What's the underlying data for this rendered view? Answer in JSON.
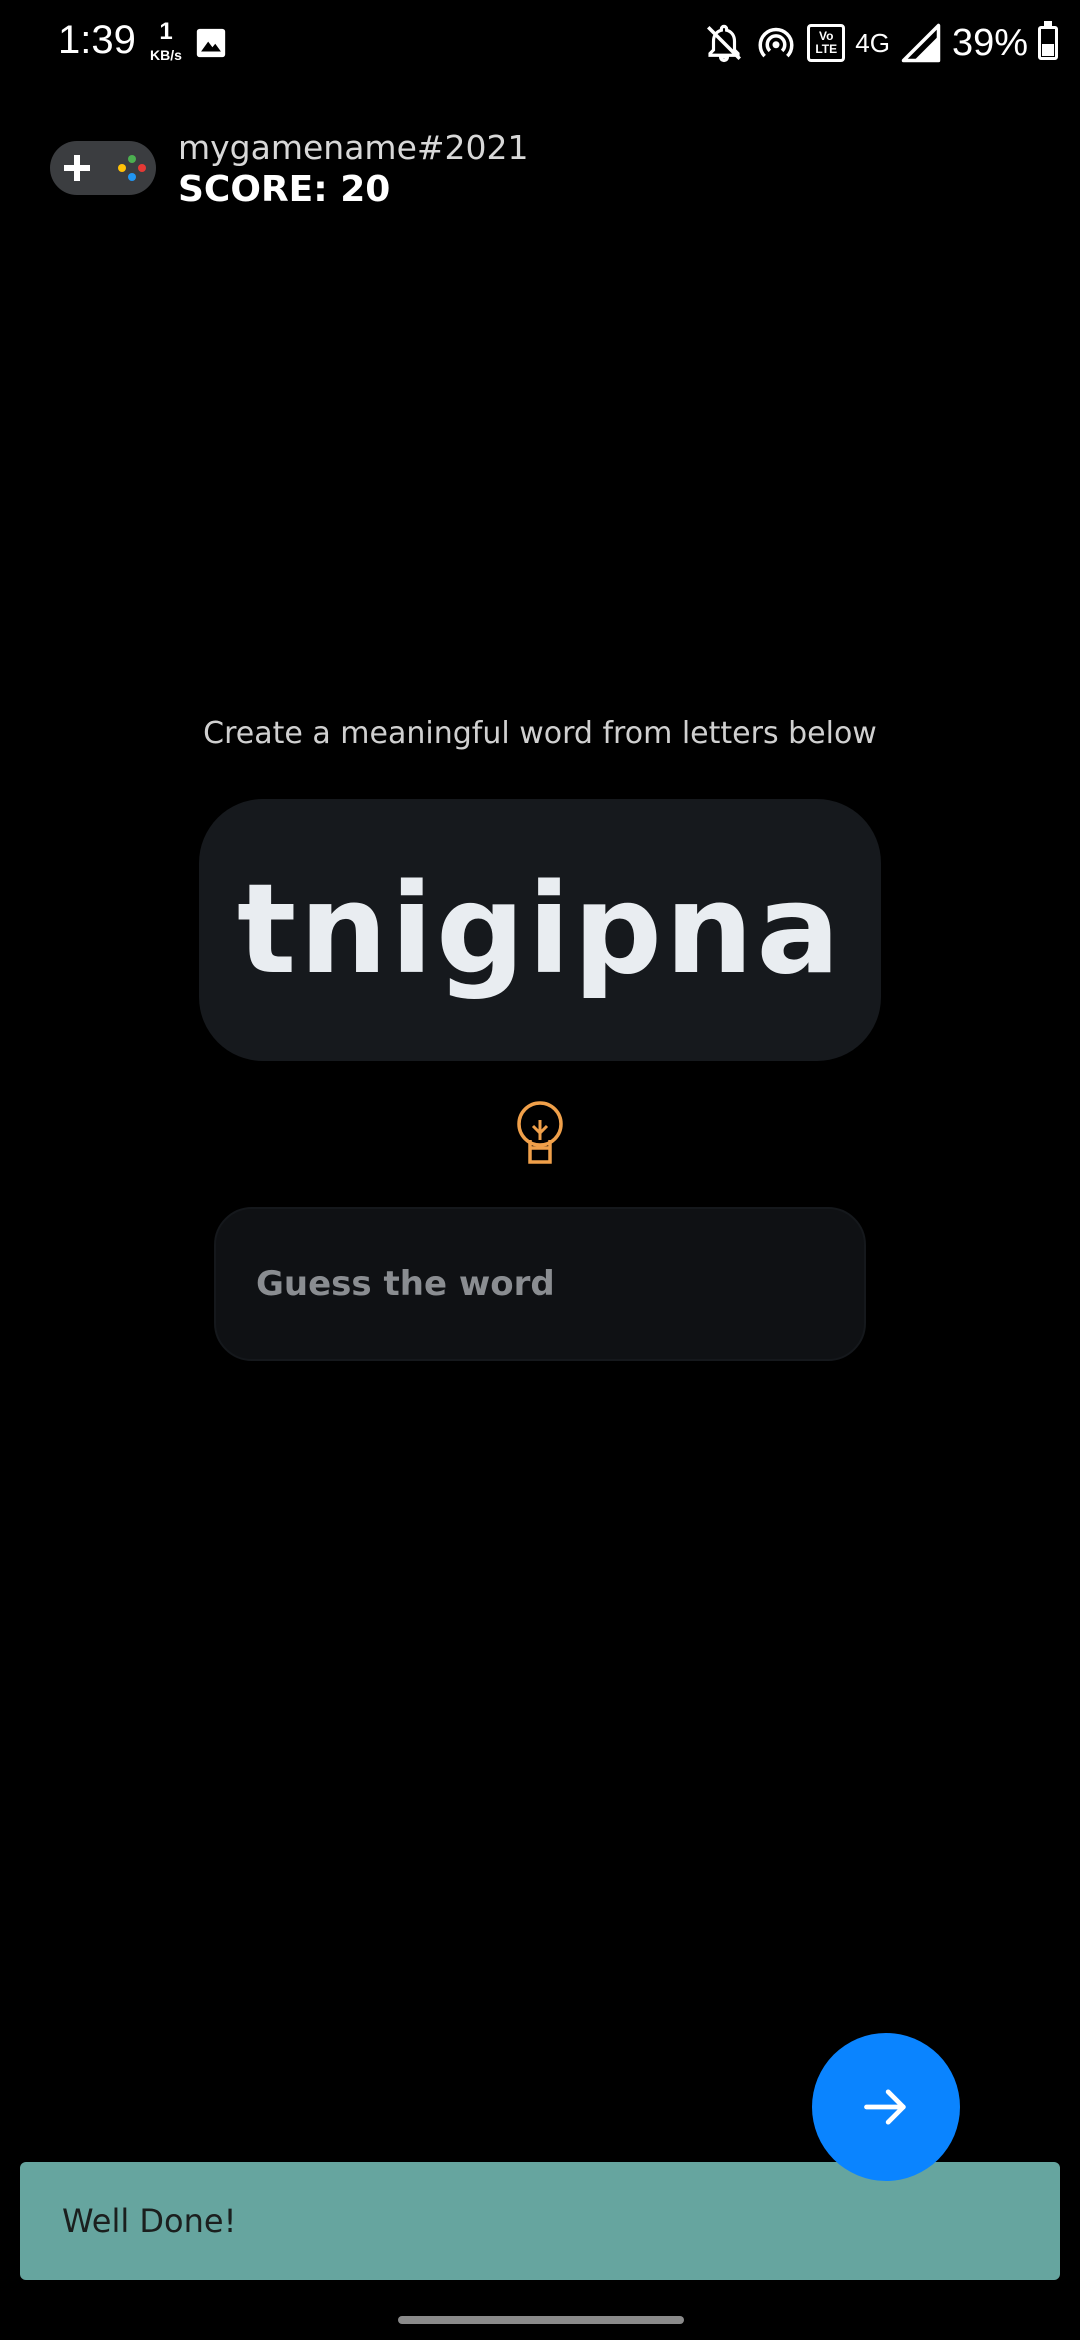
{
  "status_bar": {
    "time": "1:39",
    "net_speed_value": "1",
    "net_speed_unit": "KB/s",
    "volte_line1": "Vo",
    "volte_line2": "LTE",
    "network_type": "4G",
    "battery_percent": "39%",
    "icons": [
      "gallery-icon",
      "bell-off-icon",
      "hotspot-icon",
      "volte-icon",
      "signal-icon",
      "battery-charging-icon"
    ]
  },
  "header": {
    "player_name": "mygamename#2021",
    "score_text": "SCORE: 20",
    "icon": "gamepad-icon"
  },
  "game": {
    "instruction": "Create a meaningful word from letters below",
    "scrambled_word": "tnigipna",
    "hint_icon": "lightbulb-icon",
    "guess_placeholder": "Guess the word",
    "guess_value": ""
  },
  "fab": {
    "icon": "arrow-right-icon"
  },
  "snackbar": {
    "message": "Well Done!"
  },
  "colors": {
    "background": "#000000",
    "card": "#16191d",
    "accent_blue": "#0a84ff",
    "hint_orange": "#f0a04a",
    "snackbar": "#66a59f"
  }
}
